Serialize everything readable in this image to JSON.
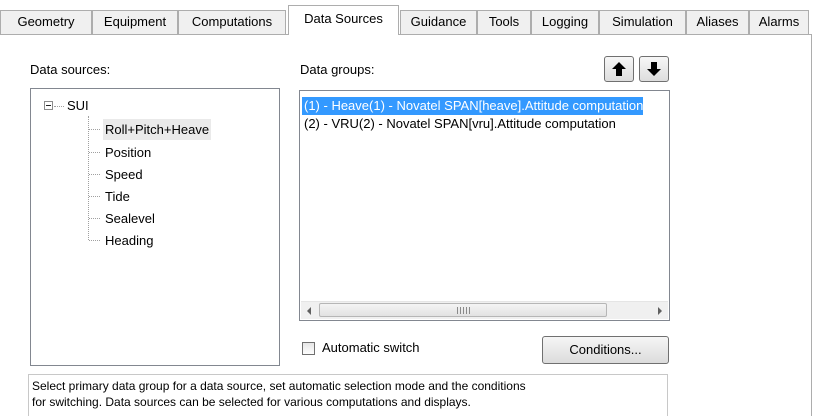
{
  "tabs": [
    {
      "label": "Geometry",
      "active": false
    },
    {
      "label": "Equipment",
      "active": false
    },
    {
      "label": "Computations",
      "active": false
    },
    {
      "label": "Data Sources",
      "active": true
    },
    {
      "label": "Guidance",
      "active": false
    },
    {
      "label": "Tools",
      "active": false
    },
    {
      "label": "Logging",
      "active": false
    },
    {
      "label": "Simulation",
      "active": false
    },
    {
      "label": "Aliases",
      "active": false
    },
    {
      "label": "Alarms",
      "active": false
    }
  ],
  "data_sources": {
    "label": "Data sources:",
    "root": "SUI",
    "items": [
      "Roll+Pitch+Heave",
      "Position",
      "Speed",
      "Tide",
      "Sealevel",
      "Heading"
    ],
    "selected": "Roll+Pitch+Heave"
  },
  "data_groups": {
    "label": "Data groups:",
    "items": [
      "(1) - Heave(1) - Novatel SPAN[heave].Attitude computation",
      "(2) - VRU(2) - Novatel SPAN[vru].Attitude computation"
    ],
    "selected_index": 0,
    "move_up_icon": "arrow-up-icon",
    "move_down_icon": "arrow-down-icon",
    "scroll_grip": "III"
  },
  "automatic_switch": {
    "label": "Automatic switch",
    "checked": false
  },
  "conditions_button": "Conditions...",
  "description": {
    "line1": "Select primary data group for a data source, set automatic selection mode and the conditions",
    "line2": "for switching. Data sources can be selected for various computations and displays."
  },
  "colors": {
    "selection": "#3399ff",
    "tree_selection": "#eaeaea",
    "border": "#adadad"
  }
}
